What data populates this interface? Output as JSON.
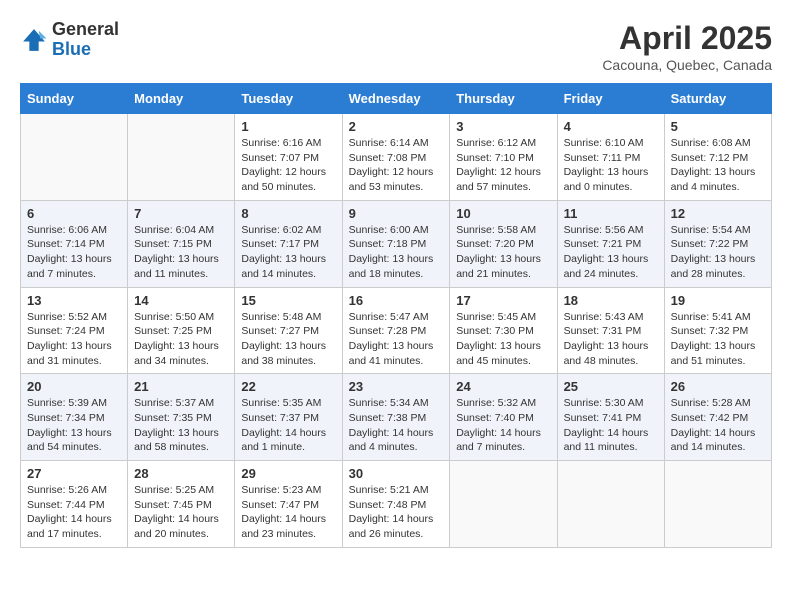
{
  "header": {
    "logo_general": "General",
    "logo_blue": "Blue",
    "month": "April 2025",
    "location": "Cacouna, Quebec, Canada"
  },
  "days_of_week": [
    "Sunday",
    "Monday",
    "Tuesday",
    "Wednesday",
    "Thursday",
    "Friday",
    "Saturday"
  ],
  "weeks": [
    [
      {
        "day": "",
        "info": ""
      },
      {
        "day": "",
        "info": ""
      },
      {
        "day": "1",
        "info": "Sunrise: 6:16 AM\nSunset: 7:07 PM\nDaylight: 12 hours and 50 minutes."
      },
      {
        "day": "2",
        "info": "Sunrise: 6:14 AM\nSunset: 7:08 PM\nDaylight: 12 hours and 53 minutes."
      },
      {
        "day": "3",
        "info": "Sunrise: 6:12 AM\nSunset: 7:10 PM\nDaylight: 12 hours and 57 minutes."
      },
      {
        "day": "4",
        "info": "Sunrise: 6:10 AM\nSunset: 7:11 PM\nDaylight: 13 hours and 0 minutes."
      },
      {
        "day": "5",
        "info": "Sunrise: 6:08 AM\nSunset: 7:12 PM\nDaylight: 13 hours and 4 minutes."
      }
    ],
    [
      {
        "day": "6",
        "info": "Sunrise: 6:06 AM\nSunset: 7:14 PM\nDaylight: 13 hours and 7 minutes."
      },
      {
        "day": "7",
        "info": "Sunrise: 6:04 AM\nSunset: 7:15 PM\nDaylight: 13 hours and 11 minutes."
      },
      {
        "day": "8",
        "info": "Sunrise: 6:02 AM\nSunset: 7:17 PM\nDaylight: 13 hours and 14 minutes."
      },
      {
        "day": "9",
        "info": "Sunrise: 6:00 AM\nSunset: 7:18 PM\nDaylight: 13 hours and 18 minutes."
      },
      {
        "day": "10",
        "info": "Sunrise: 5:58 AM\nSunset: 7:20 PM\nDaylight: 13 hours and 21 minutes."
      },
      {
        "day": "11",
        "info": "Sunrise: 5:56 AM\nSunset: 7:21 PM\nDaylight: 13 hours and 24 minutes."
      },
      {
        "day": "12",
        "info": "Sunrise: 5:54 AM\nSunset: 7:22 PM\nDaylight: 13 hours and 28 minutes."
      }
    ],
    [
      {
        "day": "13",
        "info": "Sunrise: 5:52 AM\nSunset: 7:24 PM\nDaylight: 13 hours and 31 minutes."
      },
      {
        "day": "14",
        "info": "Sunrise: 5:50 AM\nSunset: 7:25 PM\nDaylight: 13 hours and 34 minutes."
      },
      {
        "day": "15",
        "info": "Sunrise: 5:48 AM\nSunset: 7:27 PM\nDaylight: 13 hours and 38 minutes."
      },
      {
        "day": "16",
        "info": "Sunrise: 5:47 AM\nSunset: 7:28 PM\nDaylight: 13 hours and 41 minutes."
      },
      {
        "day": "17",
        "info": "Sunrise: 5:45 AM\nSunset: 7:30 PM\nDaylight: 13 hours and 45 minutes."
      },
      {
        "day": "18",
        "info": "Sunrise: 5:43 AM\nSunset: 7:31 PM\nDaylight: 13 hours and 48 minutes."
      },
      {
        "day": "19",
        "info": "Sunrise: 5:41 AM\nSunset: 7:32 PM\nDaylight: 13 hours and 51 minutes."
      }
    ],
    [
      {
        "day": "20",
        "info": "Sunrise: 5:39 AM\nSunset: 7:34 PM\nDaylight: 13 hours and 54 minutes."
      },
      {
        "day": "21",
        "info": "Sunrise: 5:37 AM\nSunset: 7:35 PM\nDaylight: 13 hours and 58 minutes."
      },
      {
        "day": "22",
        "info": "Sunrise: 5:35 AM\nSunset: 7:37 PM\nDaylight: 14 hours and 1 minute."
      },
      {
        "day": "23",
        "info": "Sunrise: 5:34 AM\nSunset: 7:38 PM\nDaylight: 14 hours and 4 minutes."
      },
      {
        "day": "24",
        "info": "Sunrise: 5:32 AM\nSunset: 7:40 PM\nDaylight: 14 hours and 7 minutes."
      },
      {
        "day": "25",
        "info": "Sunrise: 5:30 AM\nSunset: 7:41 PM\nDaylight: 14 hours and 11 minutes."
      },
      {
        "day": "26",
        "info": "Sunrise: 5:28 AM\nSunset: 7:42 PM\nDaylight: 14 hours and 14 minutes."
      }
    ],
    [
      {
        "day": "27",
        "info": "Sunrise: 5:26 AM\nSunset: 7:44 PM\nDaylight: 14 hours and 17 minutes."
      },
      {
        "day": "28",
        "info": "Sunrise: 5:25 AM\nSunset: 7:45 PM\nDaylight: 14 hours and 20 minutes."
      },
      {
        "day": "29",
        "info": "Sunrise: 5:23 AM\nSunset: 7:47 PM\nDaylight: 14 hours and 23 minutes."
      },
      {
        "day": "30",
        "info": "Sunrise: 5:21 AM\nSunset: 7:48 PM\nDaylight: 14 hours and 26 minutes."
      },
      {
        "day": "",
        "info": ""
      },
      {
        "day": "",
        "info": ""
      },
      {
        "day": "",
        "info": ""
      }
    ]
  ]
}
